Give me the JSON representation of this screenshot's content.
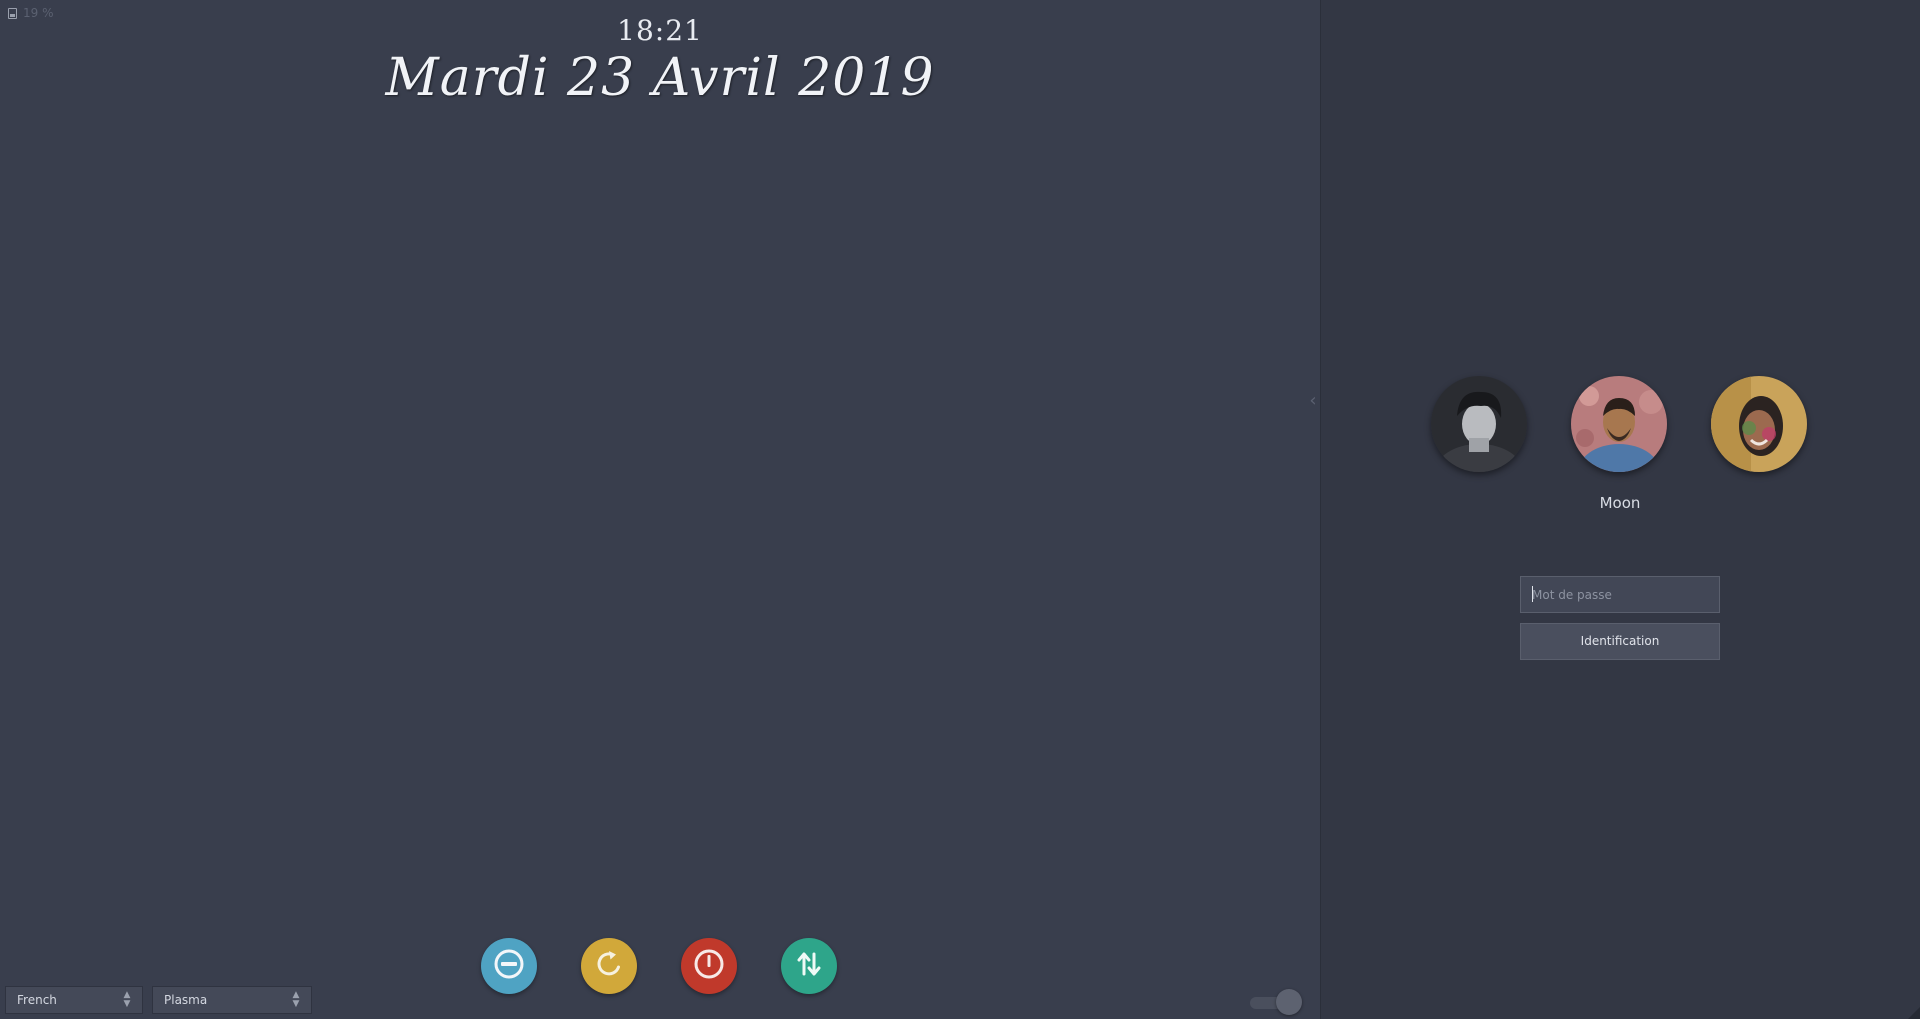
{
  "status": {
    "battery_icon": "battery-icon",
    "battery_text": "19 %"
  },
  "clock": {
    "time": "18:21",
    "date": "Mardi 23 Avril 2019"
  },
  "power_actions": [
    {
      "name": "suspend",
      "icon": "suspend-icon",
      "color": "#4fa3c3"
    },
    {
      "name": "reboot",
      "icon": "reboot-icon",
      "color": "#d1a83a"
    },
    {
      "name": "shutdown",
      "icon": "power-icon",
      "color": "#c0392b"
    },
    {
      "name": "switch",
      "icon": "switch-icon",
      "color": "#2ea58a"
    }
  ],
  "footer": {
    "keyboard_layout": "French",
    "session": "Plasma"
  },
  "login": {
    "users_count_visible": 3,
    "selected_user": "Moon",
    "password_placeholder": "Mot de passe",
    "login_button": "Identification"
  },
  "colors": {
    "background": "#393e4d",
    "panel": "#333744",
    "suspend": "#4fa3c3",
    "reboot": "#d1a83a",
    "shutdown": "#c0392b",
    "switch": "#2ea58a"
  }
}
